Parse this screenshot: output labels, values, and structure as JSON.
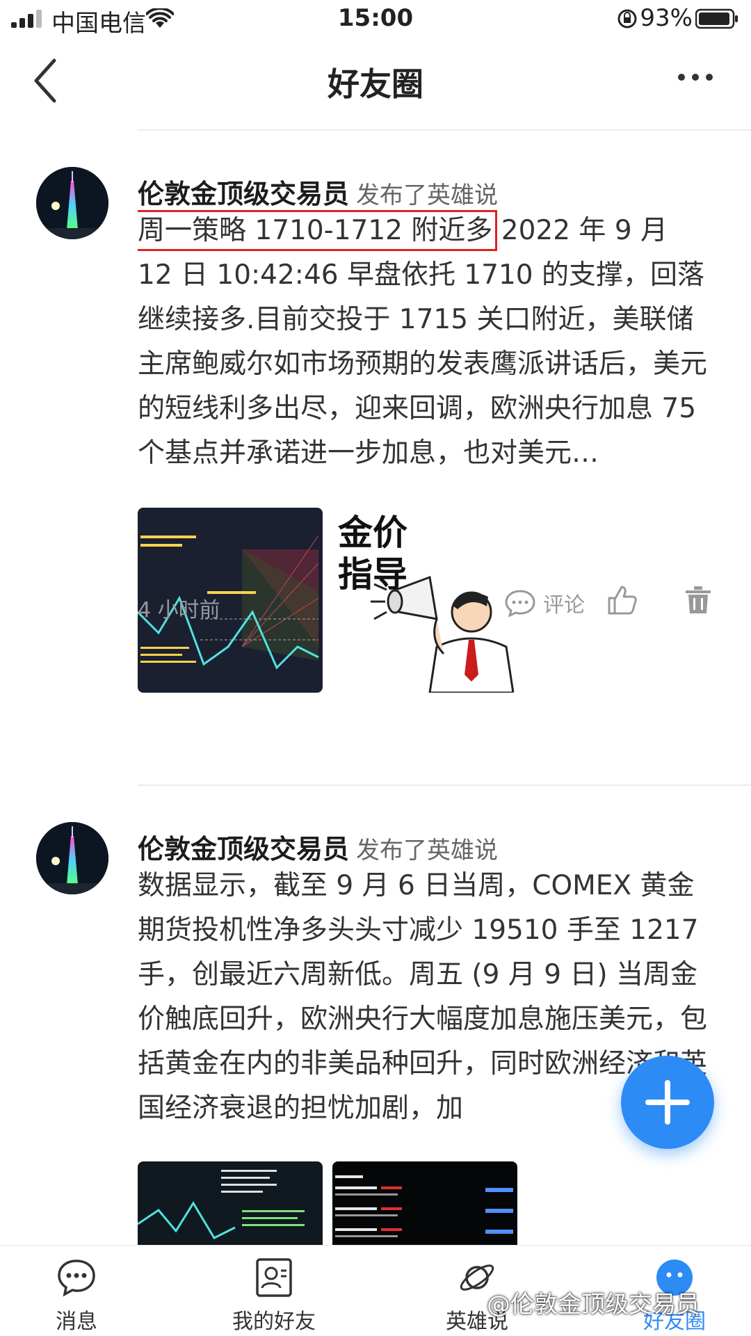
{
  "status_bar": {
    "carrier": "中国电信",
    "time": "15:00",
    "battery": "93%"
  },
  "nav": {
    "title": "好友圈"
  },
  "posts": [
    {
      "author": "伦敦金顶级交易员",
      "action": "发布了英雄说",
      "highlight": "周一策略 1710-1712 附近多",
      "text": " 2022 年 9 月 12 日 10:42:46 早盘依托 1710 的支撑，回落继续接多.目前交投于 1715 关口附近，美联储主席鲍威尔如市场预期的发表鹰派讲话后，美元的短线利多出尽，迎来回调，欧洲央行加息 75 个基点并承诺进一步加息，也对美元…",
      "image2_text": [
        "金价",
        "指导"
      ],
      "time": "4 小时前",
      "comment_label": "评论"
    },
    {
      "author": "伦敦金顶级交易员",
      "action": "发布了英雄说",
      "text": "数据显示，截至 9 月 6 日当周，COMEX 黄金期货投机性净多头头寸减少 19510 手至 1217 手，创最近六周新低。周五 (9 月 9 日) 当周金价触底回升，欧洲央行大幅度加息施压美元，包括黄金在内的非美品种回升，同时欧洲经济和英国经济衰退的担忧加剧，加"
    }
  ],
  "tabs": [
    {
      "label": "消息",
      "icon": "chat-bubble-icon"
    },
    {
      "label": "我的好友",
      "icon": "contact-card-icon"
    },
    {
      "label": "英雄说",
      "icon": "planet-icon"
    },
    {
      "label": "好友圈",
      "icon": "friends-circle-icon",
      "active": true
    }
  ],
  "watermark": "@伦敦金顶级交易员",
  "colors": {
    "accent": "#2d8bf5",
    "highlight_box": "#e02020"
  }
}
